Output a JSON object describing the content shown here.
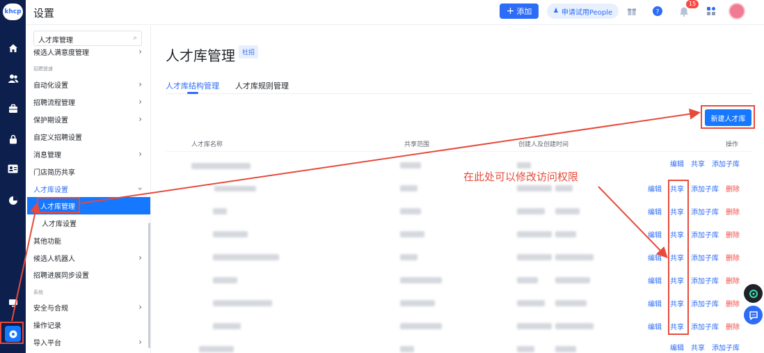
{
  "app": {
    "logo": "khcp",
    "title": "设置"
  },
  "topbar": {
    "add_label": "添加",
    "trial_label": "申请试用People",
    "notif_count": "15"
  },
  "rail": {
    "icons": [
      "home-icon",
      "users-icon",
      "briefcase-icon",
      "lock-icon",
      "idcard-icon",
      "pie-chart-icon",
      "monitor-icon",
      "settings-icon"
    ]
  },
  "sidebar": {
    "search_value": "人才库管理",
    "items": {
      "candidate_satisfaction": "候选人满意度管理",
      "section_recruit": "招聘提速",
      "automation": "自动化设置",
      "flow": "招聘流程管理",
      "protect": "保护期设置",
      "custom": "自定义招聘设置",
      "message": "消息管理",
      "store": "门店简历共享",
      "talent_settings": "人才库设置",
      "talent_manage": "人才库管理",
      "talent_config": "人才库设置",
      "other": "其他功能",
      "robot": "候选人机器人",
      "sync": "招聘进展同步设置",
      "section_system": "系统",
      "security": "安全与合规",
      "oplog": "操作记录",
      "import": "导入平台"
    }
  },
  "main": {
    "title": "人才库管理",
    "tag": "社招",
    "tabs": [
      "人才库结构管理",
      "人才库规则管理"
    ],
    "new_button": "新建人才库",
    "columns": [
      "人才库名称",
      "共享范围",
      "创建人及创建时间",
      "操作"
    ],
    "actions": {
      "edit": "编辑",
      "share": "共享",
      "add_sub": "添加子库",
      "delete": "删除"
    },
    "annotation": "在此处可以修改访问权限"
  },
  "colors": {
    "primary": "#2d6cf6",
    "rail": "#0c1f4d",
    "annotation": "#e64a3b",
    "danger": "#f54a45"
  }
}
